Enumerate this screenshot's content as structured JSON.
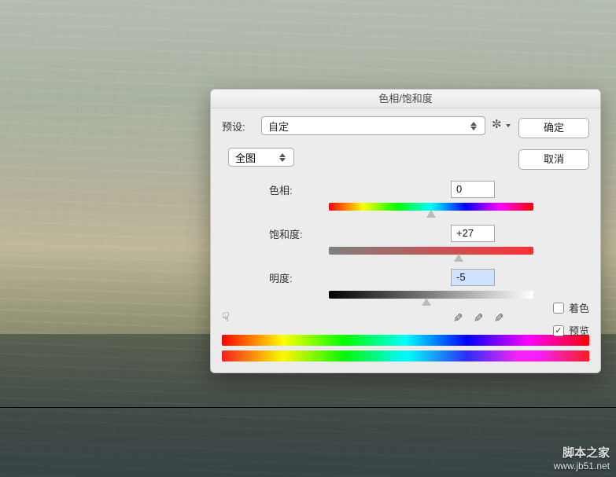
{
  "dialog": {
    "title": "色相/饱和度",
    "preset_label": "预设:",
    "preset_value": "自定",
    "range_value": "全图",
    "ok_label": "确定",
    "cancel_label": "取消",
    "colorize_label": "着色",
    "preview_label": "预览",
    "colorize_checked": false,
    "preview_checked": true,
    "sliders": {
      "hue": {
        "label": "色相:",
        "value": "0"
      },
      "sat": {
        "label": "饱和度:",
        "value": "+27"
      },
      "light": {
        "label": "明度:",
        "value": "-5"
      }
    }
  },
  "icons": {
    "gear": "gear-icon",
    "hand": "hand-scrubber-icon",
    "eyedropper": "eyedropper-icon",
    "eyedropper_add": "eyedropper-add-icon",
    "eyedropper_sub": "eyedropper-subtract-icon"
  },
  "watermark": {
    "site": "脚本之家",
    "url": "www.jb51.net"
  }
}
